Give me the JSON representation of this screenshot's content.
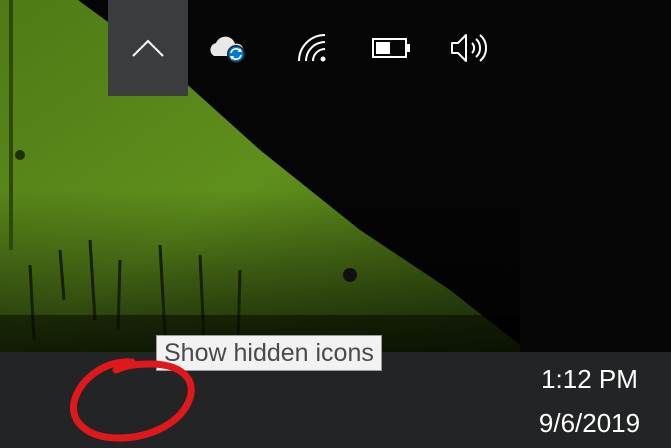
{
  "desktop": {
    "wallpaper_colors": {
      "green": "#5f8f1c",
      "dark": "#0a0a0a"
    }
  },
  "tooltip": {
    "text": "Show hidden icons"
  },
  "taskbar": {
    "background": "#222425",
    "tray": [
      {
        "name": "show-hidden-icons",
        "icon": "chevron-up-icon"
      },
      {
        "name": "onedrive-syncing",
        "icon": "onedrive-cloud-sync-icon"
      },
      {
        "name": "network-wifi",
        "icon": "wifi-icon"
      },
      {
        "name": "battery",
        "icon": "battery-icon",
        "level": 0.5
      },
      {
        "name": "volume",
        "icon": "speaker-icon"
      }
    ],
    "clock": {
      "time": "1:12 PM",
      "date": "9/6/2019"
    }
  },
  "annotation": {
    "color": "#e0181b",
    "shape": "hand-drawn-circle"
  }
}
